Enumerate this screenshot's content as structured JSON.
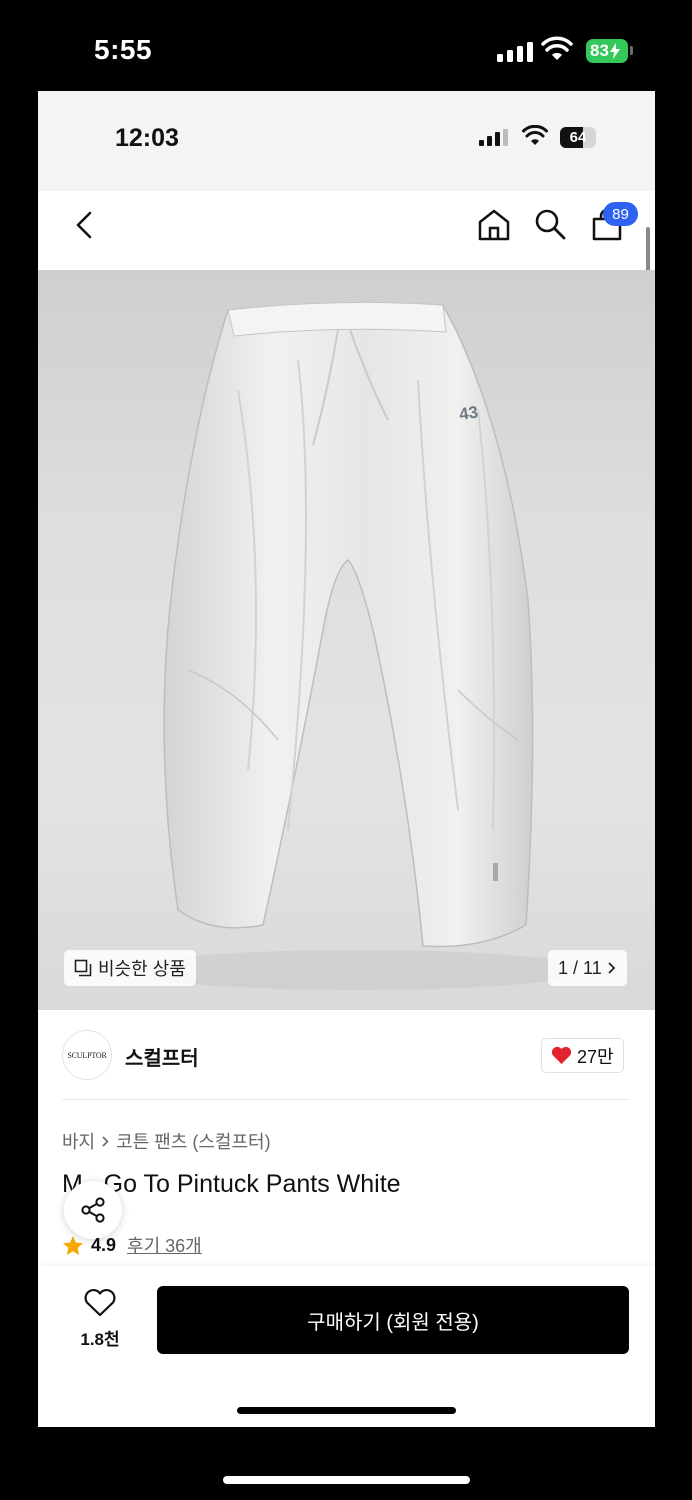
{
  "outer_status": {
    "time": "5:55",
    "battery": "83"
  },
  "inner_status": {
    "time": "12:03",
    "battery": "64",
    "battery_level_percent": 64
  },
  "nav": {
    "cart_count": "89"
  },
  "gallery": {
    "similar_label": "비슷한 상품",
    "counter": "1 / 11",
    "print_text": "43"
  },
  "brand": {
    "logo_text": "SCULPTOR",
    "name": "스컬프터",
    "likes": "27만"
  },
  "breadcrumb": {
    "category": "바지",
    "subcategory": "코튼 팬츠 (스컬프터)"
  },
  "product": {
    "title": "M_ Go To Pintuck Pants White",
    "rating": "4.9",
    "reviews": "후기 36개"
  },
  "actions": {
    "wish_count": "1.8천",
    "buy_label": "구매하기 (회원 전용)"
  },
  "colors": {
    "cart_badge": "#2d63f0",
    "heart": "#e0232c",
    "star": "#f6a800",
    "battery_green": "#34c759"
  }
}
